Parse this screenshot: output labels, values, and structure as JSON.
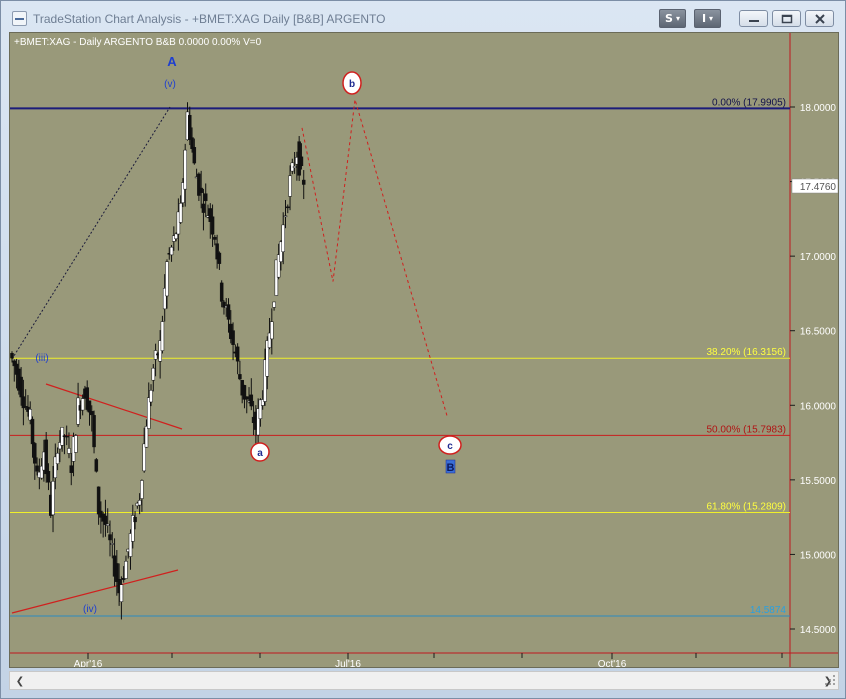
{
  "window": {
    "title": "TradeStation Chart Analysis - +BMET:XAG Daily [B&B] ARGENTO",
    "toolbar_s": "S",
    "toolbar_i": "I",
    "dropdown_glyph": "▾",
    "minimize_glyph": "—",
    "maximize_glyph": "□",
    "close_glyph": "✕"
  },
  "chart": {
    "header": "+BMET:XAG - Daily  ARGENTO  B&B  0.0000  0.00%  V=0",
    "price_axis": [
      "18.0000",
      "17.5000",
      "17.0000",
      "16.5000",
      "16.0000",
      "15.5000",
      "15.0000",
      "14.5000"
    ],
    "last_price": "17.4760",
    "date_axis": [
      "Apr'16",
      "Jul'16",
      "Oct'16"
    ],
    "fib_levels": [
      {
        "label": "0.00% (17.9905)",
        "value": 17.9905,
        "color": "#1c1c7a"
      },
      {
        "label": "38.20% (16.3156)",
        "value": 16.3156,
        "color": "#f0f02a"
      },
      {
        "label": "50.00% (15.7983)",
        "value": 15.7983,
        "color": "#c81e1e"
      },
      {
        "label": "61.80% (15.2809)",
        "value": 15.2809,
        "color": "#f0f02a"
      }
    ],
    "support_label": "14.5874",
    "support_value": 14.5874,
    "waves": {
      "A": "A",
      "v": "(v)",
      "iii": "(iii)",
      "iv": "(iv)",
      "a": "a",
      "b": "b",
      "c": "c",
      "B": "B"
    }
  },
  "chart_data": {
    "type": "candlestick",
    "title": "+BMET:XAG - Daily ARGENTO B&B",
    "y_range": [
      14.35,
      18.35
    ],
    "x_ticks": [
      "Apr'16",
      "Jul'16",
      "Oct'16"
    ],
    "trend_points": [
      [
        16.35,
        16.22,
        16.05,
        15.9,
        15.5,
        15.7,
        15.3,
        15.75,
        15.8,
        15.6,
        16.0,
        16.1,
        15.9,
        15.3,
        15.2,
        15.0,
        14.75,
        14.95,
        15.2,
        15.4,
        15.9,
        16.25,
        16.4,
        16.95,
        17.1,
        17.3,
        17.95,
        17.6,
        17.4,
        17.3,
        17.15,
        16.75,
        16.55,
        16.35,
        16.1,
        16.0,
        15.85,
        16.1,
        16.5,
        16.9,
        17.2,
        17.5,
        17.7,
        17.45
      ]
    ],
    "projection": [
      17.86,
      16.83,
      18.05,
      15.93
    ],
    "grid": false,
    "legend": "none"
  }
}
